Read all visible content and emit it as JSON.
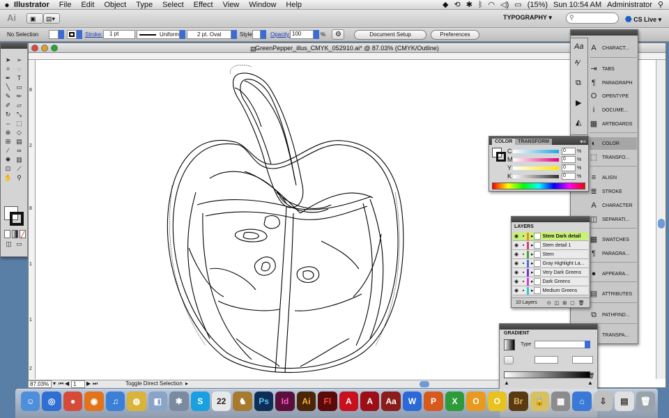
{
  "menubar": {
    "apple": "",
    "app_name": "Illustrator",
    "menus": [
      "File",
      "Edit",
      "Object",
      "Type",
      "Select",
      "Effect",
      "View",
      "Window",
      "Help"
    ],
    "battery": "(15%)",
    "clock": "Sun 10:54 AM",
    "user": "Administrator"
  },
  "appbar": {
    "logo": "Ai",
    "workspace": "TYPOGRAPHY ▾",
    "cs_live": "CS Live ▾"
  },
  "control": {
    "selection": "No Selection",
    "stroke_label": "Stroke:",
    "stroke_value": "1 pt",
    "profile": "Uniform",
    "brush": "2 pt. Oval",
    "style_label": "Style:",
    "opacity_label": "Opacity:",
    "opacity_value": "100",
    "opacity_unit": "%",
    "doc_setup": "Document Setup",
    "preferences": "Preferences"
  },
  "document": {
    "title": "GreenPepper_illus_CMYK_052910.ai* @ 87.03% (CMYK/Outline)",
    "zoom": "87.03%",
    "artboard": "1",
    "status": "Toggle Direct Selection"
  },
  "tools_ruler_labels": [
    "8",
    "2",
    "8",
    "1",
    "1",
    "2"
  ],
  "color_panel": {
    "tabs": [
      "COLOR",
      "TRANSFORM"
    ],
    "channels": [
      {
        "name": "C",
        "value": "0",
        "unit": "%",
        "color": "#1ea7e8"
      },
      {
        "name": "M",
        "value": "0",
        "unit": "%",
        "color": "#e4007c"
      },
      {
        "name": "Y",
        "value": "0",
        "unit": "%",
        "color": "#ffe500"
      },
      {
        "name": "K",
        "value": "0",
        "unit": "%",
        "color": "#333333"
      }
    ]
  },
  "layers_panel": {
    "title": "LAYERS",
    "footer": "10 Layers",
    "rows": [
      {
        "name": "Stem Dark detail",
        "color": "#f08a1d",
        "selected": true
      },
      {
        "name": "Stem detail 1",
        "color": "#e0367a"
      },
      {
        "name": "Stem",
        "color": "#42a62e"
      },
      {
        "name": "Gray Highlight La...",
        "color": "#4f6ee0"
      },
      {
        "name": "Very Dark Greens",
        "color": "#7a2ec9"
      },
      {
        "name": "Dark Greens",
        "color": "#d63bd6"
      },
      {
        "name": "Medium Greens",
        "color": "#2ec9c9"
      }
    ]
  },
  "gradient_panel": {
    "title": "GRADIENT",
    "type_label": "Type"
  },
  "dock_panels": [
    {
      "label": "CHARACT...",
      "icon": "A"
    },
    {
      "label": "TABS",
      "icon": "⇥"
    },
    {
      "label": "PARAGRAPH",
      "icon": "¶"
    },
    {
      "label": "OPENTYPE",
      "icon": "O"
    },
    {
      "label": "DOCUME...",
      "icon": "i"
    },
    {
      "label": "ARTBOARDS",
      "icon": "▦"
    },
    {
      "label": "COLOR",
      "icon": "◐"
    },
    {
      "label": "TRANSFO...",
      "icon": "⬚"
    },
    {
      "label": "ALIGN",
      "icon": "≡"
    },
    {
      "label": "STROKE",
      "icon": "≣"
    },
    {
      "label": "CHARACTER",
      "icon": "A"
    },
    {
      "label": "SEPARATI...",
      "icon": "◫"
    },
    {
      "label": "SWATCHES",
      "icon": "▦"
    },
    {
      "label": "PARAGRA...",
      "icon": "¶"
    },
    {
      "label": "APPEARA...",
      "icon": "●"
    },
    {
      "label": "ATTRIBUTES",
      "icon": "▤"
    },
    {
      "label": "PATHFIND...",
      "icon": "⧉"
    },
    {
      "label": "TRANSPA...",
      "icon": "◎"
    }
  ],
  "dock_apps": [
    {
      "label": "Finder",
      "glyph": "☺",
      "color": "#4e8fdc"
    },
    {
      "label": "Safari",
      "glyph": "◎",
      "color": "#2f6fd1"
    },
    {
      "label": "Chrome",
      "glyph": "●",
      "color": "#d64a3a"
    },
    {
      "label": "Firefox",
      "glyph": "◉",
      "color": "#e2731b"
    },
    {
      "label": "iTunes",
      "glyph": "♫",
      "color": "#3b7fd6"
    },
    {
      "label": "Volleyball",
      "glyph": "◍",
      "color": "#d8b43a"
    },
    {
      "label": "Preview",
      "glyph": "◧",
      "color": "#8aa4c9"
    },
    {
      "label": "Photos",
      "glyph": "✱",
      "color": "#7a8aa0"
    },
    {
      "label": "Skype",
      "glyph": "S",
      "color": "#18a0e0"
    },
    {
      "label": "iCal",
      "glyph": "22",
      "color": "#e8e8e8"
    },
    {
      "label": "Horse",
      "glyph": "♞",
      "color": "#a87a2e"
    },
    {
      "label": "Photoshop",
      "glyph": "Ps",
      "color": "#0d2f55"
    },
    {
      "label": "InDesign",
      "glyph": "Id",
      "color": "#5b0f3b"
    },
    {
      "label": "Illustrator",
      "glyph": "Ai",
      "color": "#4a2608"
    },
    {
      "label": "Flash",
      "glyph": "Fl",
      "color": "#5a0a0a"
    },
    {
      "label": "Acrobat",
      "glyph": "A",
      "color": "#c8101e"
    },
    {
      "label": "Acrobat Pro",
      "glyph": "A",
      "color": "#9c0f16"
    },
    {
      "label": "Dictionary",
      "glyph": "Aa",
      "color": "#8a1c1c"
    },
    {
      "label": "Word",
      "glyph": "W",
      "color": "#2b6ad6"
    },
    {
      "label": "PowerPoint",
      "glyph": "P",
      "color": "#d65a1e"
    },
    {
      "label": "Excel",
      "glyph": "X",
      "color": "#2e9a3a"
    },
    {
      "label": "Outlook",
      "glyph": "O",
      "color": "#e89a1e"
    },
    {
      "label": "Messenger",
      "glyph": "O",
      "color": "#e8c21e"
    },
    {
      "label": "Bridge",
      "glyph": "Br",
      "color": "#5a3a12"
    },
    {
      "label": "Keychain",
      "glyph": "🔒",
      "color": "#d8c060"
    },
    {
      "label": "Calculator",
      "glyph": "▦",
      "color": "#8c8c8c"
    },
    {
      "label": "App Store",
      "glyph": "⌂",
      "color": "#3a7ad6"
    },
    {
      "label": "Downloads",
      "glyph": "⇩",
      "color": "#c0c0c0"
    },
    {
      "label": "Documents",
      "glyph": "▤",
      "color": "#e0e0e0"
    },
    {
      "label": "Trash",
      "glyph": "🗑",
      "color": "#9aa2ac"
    }
  ]
}
